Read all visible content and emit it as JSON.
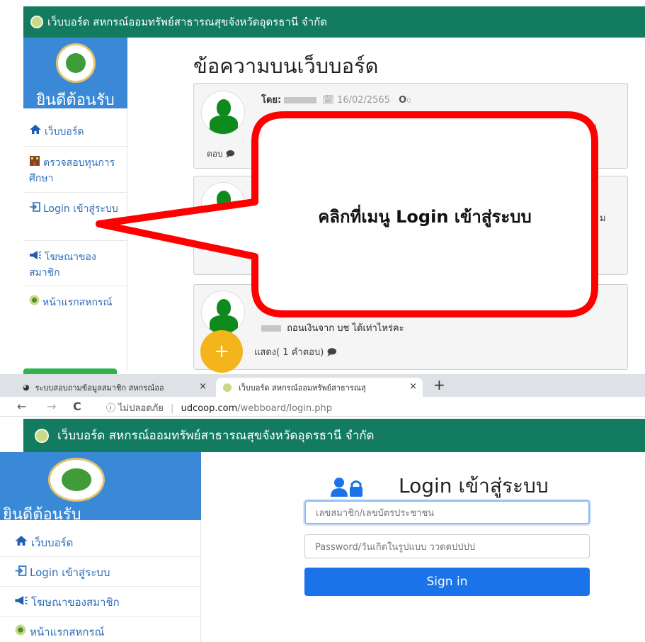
{
  "top": {
    "header_title": "เว็บบอร์ด สหกรณ์ออมทรัพย์สาธารณสุขจังหวัดอุดรธานี จำกัด",
    "welcome": "ยินดีต้อนรับ",
    "sidebar": [
      {
        "icon": "home-icon",
        "label": "เว็บบอร์ด"
      },
      {
        "icon": "building-icon",
        "label": "ตรวจสอบทุนการศึกษา"
      },
      {
        "icon": "login-icon",
        "label": "Login เข้าสู่ระบบ"
      },
      {
        "icon": "megaphone-icon",
        "label": "โฆษณาของสมาชิก"
      },
      {
        "icon": "coop-logo-icon",
        "label": "หน้าแรกสหกรณ์"
      }
    ],
    "page_title": "ข้อความบนเว็บบอร์ด",
    "posts": [
      {
        "by_label": "โดย:",
        "date": "16/02/2565",
        "count": "0",
        "tail": "แค่ะ",
        "reply_label": "ตอบ"
      },
      {
        "tail": "ม"
      },
      {
        "message": "ถอนเงินจาก บช ได้เท่าไหร่คะ",
        "show_label": "แสดง( 1 คำตอบ)"
      }
    ],
    "fab_label": "+",
    "callout": "คลิกที่เมนู Login เข้าสู่ระบบ"
  },
  "browser": {
    "tabs": [
      {
        "label": "ระบบสอบถามข้อมูลสมาชิก สหกรณ์ออ",
        "close": "×"
      },
      {
        "label": "เว็บบอร์ด สหกรณ์ออมทรัพย์สาธารณสุ",
        "close": "×"
      }
    ],
    "new_tab": "+",
    "back": "←",
    "forward": "→",
    "reload": "C",
    "security": "ⓘ ไม่ปลอดภัย",
    "separator": "|",
    "url_host": "udcoop.com",
    "url_path": "/webboard/login.php"
  },
  "bottom": {
    "header_title": "เว็บบอร์ด สหกรณ์ออมทรัพย์สาธารณสุขจังหวัดอุดรธานี จำกัด",
    "welcome": "ยินดีต้อนรับ",
    "sidebar": [
      {
        "icon": "home-icon",
        "label": "เว็บบอร์ด"
      },
      {
        "icon": "login-icon",
        "label": "Login เข้าสู่ระบบ"
      },
      {
        "icon": "megaphone-icon",
        "label": "โฆษณาของสมาชิก"
      },
      {
        "icon": "coop-logo-icon",
        "label": "หน้าแรกสหกรณ์"
      }
    ],
    "login_title": "Login เข้าสู่ระบบ",
    "username_placeholder": "เลขสมาชิก/เลขบัตรประชาชน",
    "password_placeholder": "Password/วันเกิดในรูปแบบ ววดดปปปป",
    "signin_label": "Sign in"
  },
  "colors": {
    "header": "#137c60",
    "sidebar_head": "#3a89d6",
    "link": "#2f6fb8",
    "primary": "#1a73e8",
    "callout_border": "#ff0000",
    "fab": "#f3b51b"
  }
}
